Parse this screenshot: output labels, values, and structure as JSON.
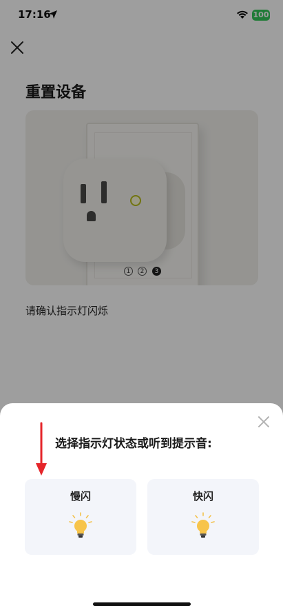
{
  "status_bar": {
    "time": "17:16",
    "battery": "100"
  },
  "page": {
    "title": "重置设备",
    "steps": [
      "1",
      "2",
      "3"
    ],
    "active_step": "3",
    "instruction": "请确认指示灯闪烁"
  },
  "sheet": {
    "title": "选择指示灯状态或听到提示音:",
    "options": [
      {
        "label": "慢闪",
        "icon": "bulb-icon"
      },
      {
        "label": "快闪",
        "icon": "bulb-icon"
      }
    ]
  },
  "colors": {
    "overlay": "#000000",
    "battery": "#34c759",
    "arrow": "#e5252a",
    "option_bg": "#f3f5fa",
    "bulb": "#f7c44a"
  }
}
